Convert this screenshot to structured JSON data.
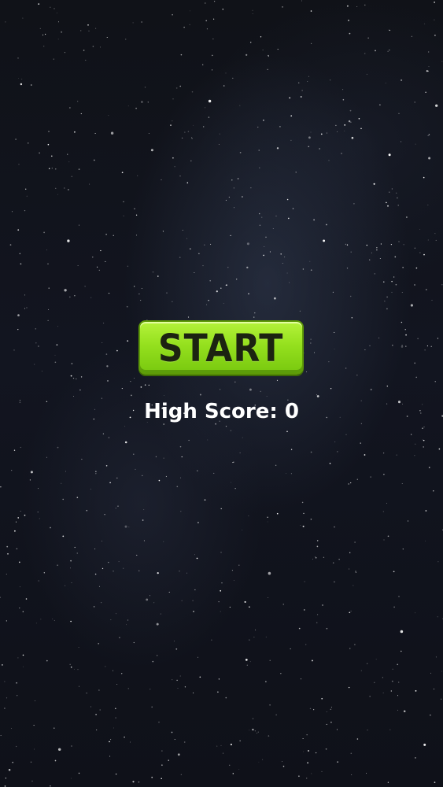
{
  "game": {
    "start_label": "START",
    "high_score_text": "High Score: 0"
  },
  "colors": {
    "background": "#121520",
    "button_green": "#95e01e",
    "button_text": "#1c2311",
    "score_text": "#ffffff"
  }
}
